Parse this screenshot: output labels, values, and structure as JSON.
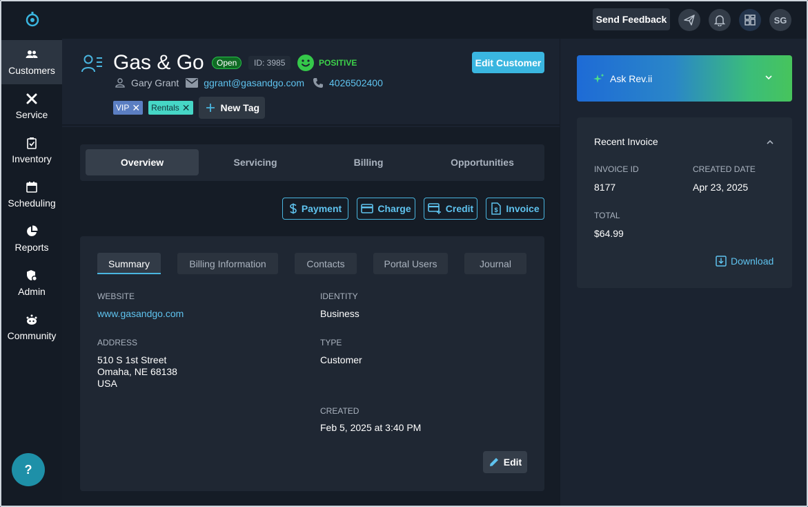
{
  "topbar": {
    "feedback_label": "Send Feedback",
    "avatar_initials": "SG"
  },
  "sidebar": {
    "items": [
      {
        "label": "Customers",
        "icon": "people-icon"
      },
      {
        "label": "Service",
        "icon": "tools-icon"
      },
      {
        "label": "Inventory",
        "icon": "clipboard-check-icon"
      },
      {
        "label": "Scheduling",
        "icon": "calendar-icon"
      },
      {
        "label": "Reports",
        "icon": "pie-chart-icon"
      },
      {
        "label": "Admin",
        "icon": "shield-gear-icon"
      },
      {
        "label": "Community",
        "icon": "community-icon"
      }
    ],
    "help_label": "?"
  },
  "customer": {
    "name": "Gas & Go",
    "status": "Open",
    "id_label": "ID: 3985",
    "sentiment": "POSITIVE",
    "edit_label": "Edit Customer",
    "contact_name": "Gary Grant",
    "email": "ggrant@gasandgo.com",
    "phone": "4026502400",
    "tags": [
      "VIP",
      "Rentals"
    ],
    "new_tag_label": "New Tag"
  },
  "tabs": [
    "Overview",
    "Servicing",
    "Billing",
    "Opportunities"
  ],
  "actions": [
    "Payment",
    "Charge",
    "Credit",
    "Invoice"
  ],
  "subtabs": [
    "Summary",
    "Billing Information",
    "Contacts",
    "Portal Users",
    "Journal"
  ],
  "summary": {
    "website_label": "WEBSITE",
    "website": "www.gasandgo.com",
    "address_label": "ADDRESS",
    "address_line1": "510 S 1st Street",
    "address_line2": "Omaha, NE 68138",
    "address_line3": "USA",
    "identity_label": "IDENTITY",
    "identity": "Business",
    "type_label": "TYPE",
    "type": "Customer",
    "created_label": "CREATED",
    "created": "Feb 5, 2025 at 3:40 PM",
    "edit_label": "Edit"
  },
  "ask_rev": {
    "label": "Ask Rev.ii"
  },
  "recent_invoice": {
    "title": "Recent Invoice",
    "invoice_id_label": "INVOICE ID",
    "invoice_id": "8177",
    "created_label": "CREATED DATE",
    "created": "Apr 23, 2025",
    "total_label": "TOTAL",
    "total": "$64.99",
    "download_label": "Download"
  },
  "colors": {
    "accent": "#4ab6e0",
    "positive": "#35c84a",
    "background": "#1b2330"
  }
}
